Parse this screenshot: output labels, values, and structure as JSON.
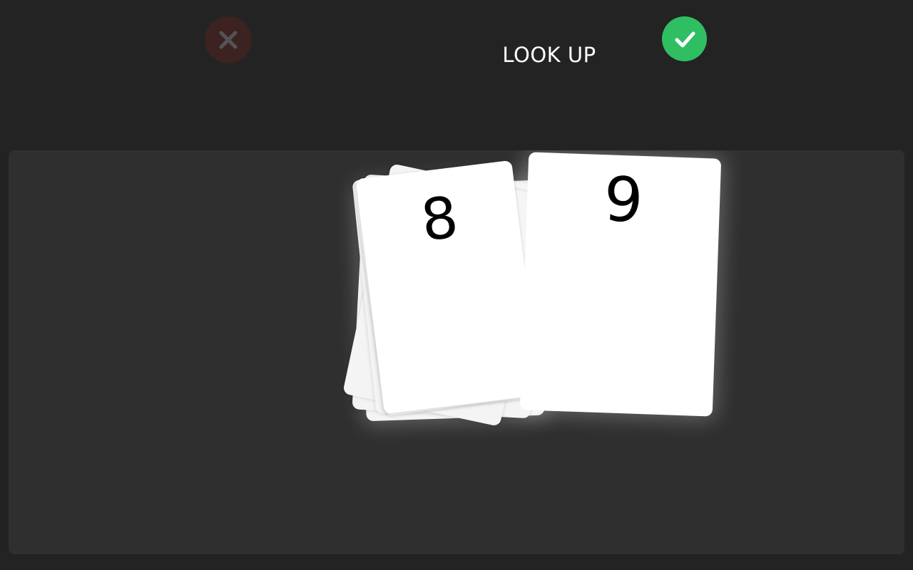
{
  "header": {
    "instruction": "LOOK UP",
    "wrong_icon": "close-icon",
    "right_icon": "check-icon"
  },
  "colors": {
    "background": "#232323",
    "table": "#2f2f2f",
    "wrong_button": "#3d2222",
    "right_button": "#2fbf62",
    "card": "#ffffff"
  },
  "cards": {
    "left_pile_top": "8",
    "right_card": "9"
  }
}
